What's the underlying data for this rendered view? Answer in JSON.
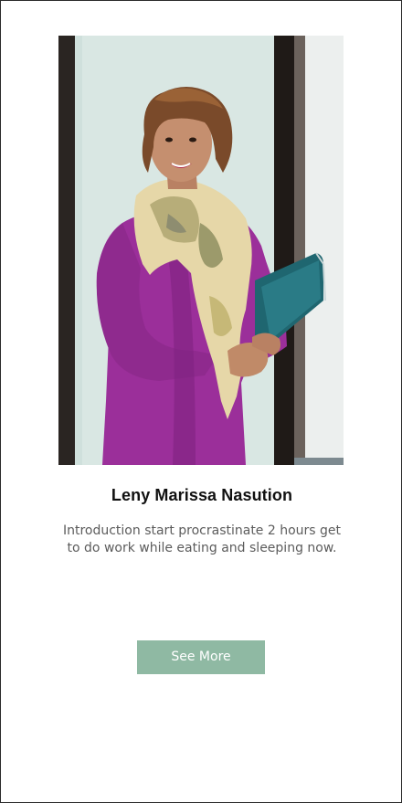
{
  "profile": {
    "photo": "portrait-photo",
    "name": "Leny Marissa Nasution",
    "introduction": "Introduction start procrastinate 2 hours get to do work while eating and sleeping now."
  },
  "actions": {
    "see_more_label": "See More"
  },
  "colors": {
    "button_bg": "#8fb9a3",
    "button_text": "#ffffff",
    "name_text": "#111111",
    "intro_text": "#5c5c5c",
    "frame_border": "#2b2b2b"
  }
}
